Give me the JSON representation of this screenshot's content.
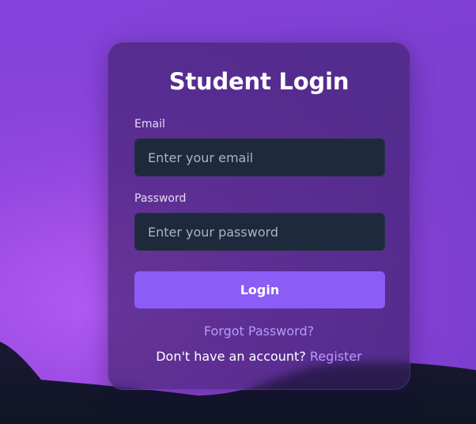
{
  "login_card": {
    "title": "Student Login",
    "email_label": "Email",
    "email_placeholder": "Enter your email",
    "email_value": "",
    "password_label": "Password",
    "password_placeholder": "Enter your password",
    "password_value": "",
    "login_button": "Login",
    "forgot_password": "Forgot Password?",
    "register_prompt": "Don't have an account?",
    "register_link": "Register"
  },
  "colors": {
    "background": "#9b4de6",
    "card": "#3a1e64",
    "input_bg": "#1e293b",
    "button": "#8b5cf6",
    "link": "#b79af7",
    "ground": "#111827"
  }
}
